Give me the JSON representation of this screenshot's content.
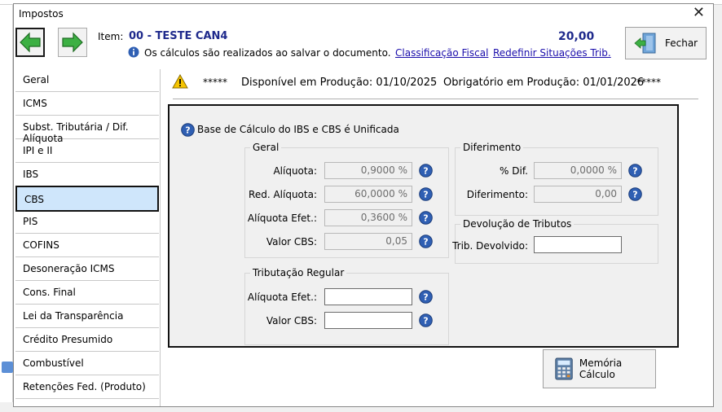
{
  "window": {
    "title": "Impostos"
  },
  "header": {
    "item_label": "Item:",
    "item_value": "00 - TESTE CAN4",
    "info_text": "Os cálculos são realizados ao salvar o documento.",
    "link_classificacao": "Classificação Fiscal",
    "link_redefinir": "Redefinir Situações Trib.",
    "total": "20,00",
    "fechar_label": "Fechar"
  },
  "sidebar": {
    "items": [
      {
        "label": "Geral"
      },
      {
        "label": "ICMS"
      },
      {
        "label": "Subst. Tributária / Dif. Alíquota"
      },
      {
        "label": "IPI e II"
      },
      {
        "label": "IBS"
      },
      {
        "label": "CBS"
      },
      {
        "label": "PIS"
      },
      {
        "label": "COFINS"
      },
      {
        "label": "Desoneração ICMS"
      },
      {
        "label": "Cons. Final"
      },
      {
        "label": "Lei da Transparência"
      },
      {
        "label": "Crédito Presumido"
      },
      {
        "label": "Combustível"
      },
      {
        "label": "Retenções Fed. (Produto)"
      }
    ],
    "selected": "CBS"
  },
  "notice": {
    "stars": "*****",
    "disponivel": "Disponível em Produção: 01/10/2025",
    "obrigatorio": "Obrigatório em Produção: 01/01/2026"
  },
  "panel": {
    "title": "Base de Cálculo do IBS e CBS é Unificada",
    "geral": {
      "title": "Geral",
      "aliquota_label": "Alíquota:",
      "aliquota_value": "0,9000 %",
      "red_aliquota_label": "Red. Alíquota:",
      "red_aliquota_value": "60,0000 %",
      "aliquota_efet_label": "Alíquota Efet.:",
      "aliquota_efet_value": "0,3600 %",
      "valor_cbs_label": "Valor CBS:",
      "valor_cbs_value": "0,05"
    },
    "tributacao_regular": {
      "title": "Tributação Regular",
      "aliquota_efet_label": "Alíquota Efet.:",
      "aliquota_efet_value": "",
      "valor_cbs_label": "Valor CBS:",
      "valor_cbs_value": ""
    },
    "diferimento": {
      "title": "Diferimento",
      "pct_dif_label": "% Dif.",
      "pct_dif_value": "0,0000 %",
      "diferimento_label": "Diferimento:",
      "diferimento_value": "0,00"
    },
    "devolucao": {
      "title": "Devolução de Tributos",
      "trib_devolvido_label": "Trib. Devolvido:",
      "trib_devolvido_value": ""
    }
  },
  "memoria_label": "Memória Cálculo",
  "colors": {
    "accent_blue": "#1f2a8c",
    "link": "#1a0dab",
    "selected_bg": "#cfe6fb",
    "arrow_green": "#3cb043",
    "help_blue": "#2f5fb3"
  }
}
